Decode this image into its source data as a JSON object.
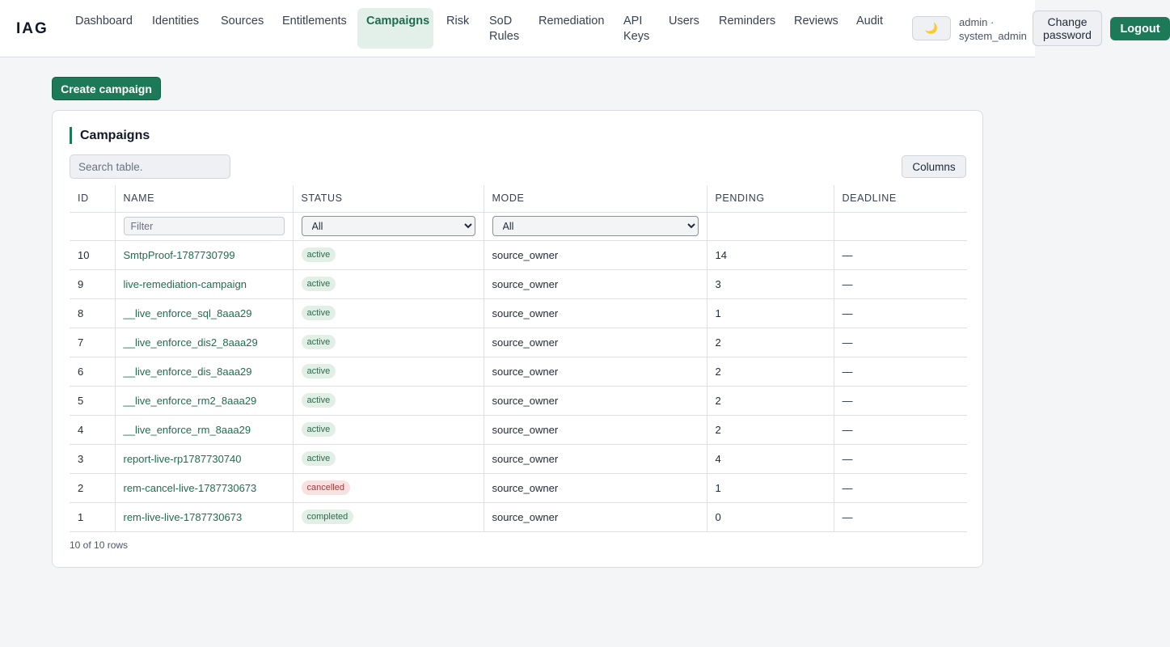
{
  "app": {
    "brand": "IAG"
  },
  "nav": {
    "items": [
      {
        "label": "Dashboard",
        "active": false
      },
      {
        "label": "Identities",
        "active": false
      },
      {
        "label": "Sources",
        "active": false
      },
      {
        "label": "Entitlements",
        "active": false
      },
      {
        "label": "Campaigns",
        "active": true
      },
      {
        "label": "Risk",
        "active": false
      },
      {
        "label": "SoD Rules",
        "active": false
      },
      {
        "label": "Remediation",
        "active": false
      },
      {
        "label": "API Keys",
        "active": false
      },
      {
        "label": "Users",
        "active": false
      },
      {
        "label": "Reminders",
        "active": false
      },
      {
        "label": "Reviews",
        "active": false
      },
      {
        "label": "Audit",
        "active": false
      }
    ],
    "theme_toggle_icon": "🌙",
    "user_label": "admin · system_admin",
    "change_password_label": "Change password",
    "logout_label": "Logout"
  },
  "page": {
    "create_button_label": "Create campaign",
    "card_title": "Campaigns",
    "search_placeholder": "Search table.",
    "columns_button_label": "Columns",
    "filter_placeholder": "Filter",
    "status_filter_value": "All",
    "mode_filter_value": "All",
    "row_count": "10 of 10 rows"
  },
  "table": {
    "columns": [
      "ID",
      "NAME",
      "STATUS",
      "MODE",
      "PENDING",
      "DEADLINE"
    ],
    "rows": [
      {
        "id": "10",
        "name": "SmtpProof-1787730799",
        "status": "active",
        "mode": "source_owner",
        "pending": "14",
        "deadline": "—"
      },
      {
        "id": "9",
        "name": "live-remediation-campaign",
        "status": "active",
        "mode": "source_owner",
        "pending": "3",
        "deadline": "—"
      },
      {
        "id": "8",
        "name": "__live_enforce_sql_8aaa29",
        "status": "active",
        "mode": "source_owner",
        "pending": "1",
        "deadline": "—"
      },
      {
        "id": "7",
        "name": "__live_enforce_dis2_8aaa29",
        "status": "active",
        "mode": "source_owner",
        "pending": "2",
        "deadline": "—"
      },
      {
        "id": "6",
        "name": "__live_enforce_dis_8aaa29",
        "status": "active",
        "mode": "source_owner",
        "pending": "2",
        "deadline": "—"
      },
      {
        "id": "5",
        "name": "__live_enforce_rm2_8aaa29",
        "status": "active",
        "mode": "source_owner",
        "pending": "2",
        "deadline": "—"
      },
      {
        "id": "4",
        "name": "__live_enforce_rm_8aaa29",
        "status": "active",
        "mode": "source_owner",
        "pending": "2",
        "deadline": "—"
      },
      {
        "id": "3",
        "name": "report-live-rp1787730740",
        "status": "active",
        "mode": "source_owner",
        "pending": "4",
        "deadline": "—"
      },
      {
        "id": "2",
        "name": "rem-cancel-live-1787730673",
        "status": "cancelled",
        "mode": "source_owner",
        "pending": "1",
        "deadline": "—"
      },
      {
        "id": "1",
        "name": "rem-live-live-1787730673",
        "status": "completed",
        "mode": "source_owner",
        "pending": "0",
        "deadline": "—"
      }
    ]
  },
  "colors": {
    "accent": "#1d7a58",
    "active_tab_bg": "#e3efe9",
    "badge_ok_bg": "#e1efe6",
    "badge_cancel_bg": "#f8e1e1"
  }
}
